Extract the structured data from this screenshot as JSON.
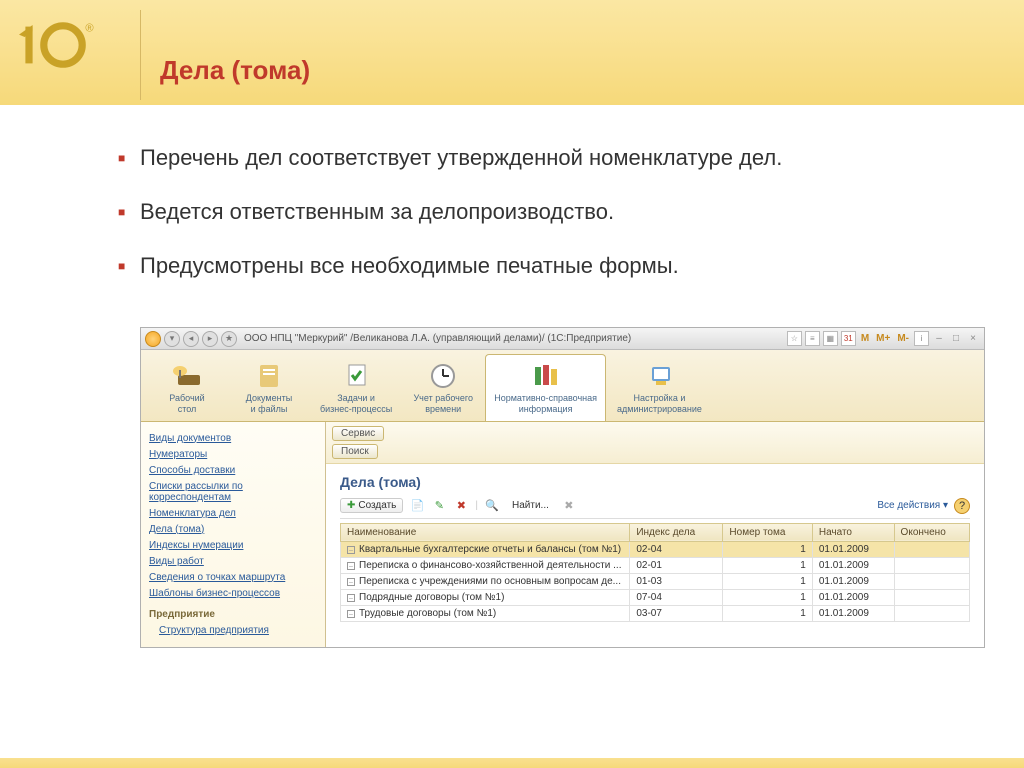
{
  "slide": {
    "title": "Дела (тома)",
    "bullets": [
      "Перечень дел соответствует утвержденной номенклатуре дел.",
      "Ведется ответственным за делопроизводство.",
      "Предусмотрены все необходимые печатные формы."
    ]
  },
  "app": {
    "titlebar": "ООО НПЦ \"Меркурий\" /Великанова Л.А. (управляющий делами)/  (1С:Предприятие)",
    "tb_m": [
      "M",
      "M+",
      "M-"
    ],
    "sections": [
      {
        "label": "Рабочий\nстол"
      },
      {
        "label": "Документы\nи файлы"
      },
      {
        "label": "Задачи и\nбизнес-процессы"
      },
      {
        "label": "Учет рабочего\nвремени"
      },
      {
        "label": "Нормативно-справочная\nинформация"
      },
      {
        "label": "Настройка и\nадминистрирование"
      }
    ],
    "sidebar": [
      "Виды документов",
      "Нумераторы",
      "Способы доставки",
      "Списки рассылки по корреспондентам",
      "Номенклатура дел",
      "Дела (тома)",
      "Индексы нумерации",
      "Виды работ",
      "Сведения о точках маршрута",
      "Шаблоны бизнес-процессов"
    ],
    "sidebar_group": "Предприятие",
    "sidebar_sub": "Структура предприятия",
    "service": {
      "btn1": "Сервис",
      "btn2": "Поиск"
    },
    "panel_title": "Дела (тома)",
    "toolbar": {
      "create": "Создать",
      "find": "Найти...",
      "all": "Все действия ▾",
      "help": "?"
    },
    "columns": [
      "Наименование",
      "Индекс дела",
      "Номер тома",
      "Начато",
      "Окончено"
    ],
    "rows": [
      {
        "name": "Квартальные бухгалтерские отчеты и балансы (том №1)",
        "idx": "02-04",
        "num": "1",
        "start": "01.01.2009",
        "end": ""
      },
      {
        "name": "Переписка о финансово-хозяйственной деятельности ...",
        "idx": "02-01",
        "num": "1",
        "start": "01.01.2009",
        "end": ""
      },
      {
        "name": "Переписка с учреждениями по основным вопросам де...",
        "idx": "01-03",
        "num": "1",
        "start": "01.01.2009",
        "end": ""
      },
      {
        "name": "Подрядные договоры (том №1)",
        "idx": "07-04",
        "num": "1",
        "start": "01.01.2009",
        "end": ""
      },
      {
        "name": "Трудовые договоры (том №1)",
        "idx": "03-07",
        "num": "1",
        "start": "01.01.2009",
        "end": ""
      }
    ]
  }
}
